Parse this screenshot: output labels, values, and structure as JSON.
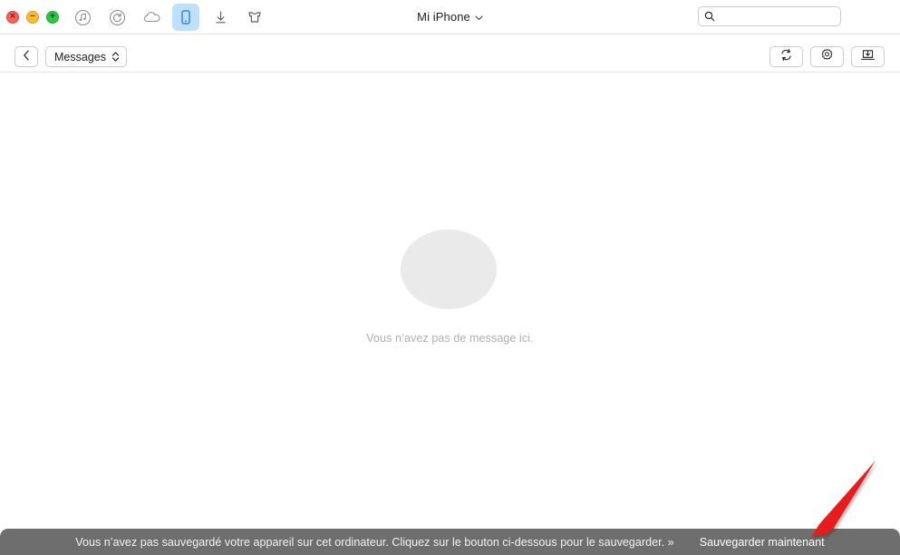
{
  "window": {
    "title": "Mi iPhone",
    "title_chevron": "chevron-down",
    "traffic_lights": {
      "close_glyph": "×",
      "minimize_glyph": "−",
      "maximize_glyph": "+",
      "close_color": "#ff5f57",
      "minimize_color": "#febc2e",
      "maximize_color": "#28c840"
    },
    "nav_icons": [
      {
        "name": "music-icon",
        "label": "Musique",
        "active": false
      },
      {
        "name": "podcast-icon",
        "label": "Podcasts",
        "active": false
      },
      {
        "name": "cloud-icon",
        "label": "iCloud",
        "active": false
      },
      {
        "name": "iphone-device-icon",
        "label": "Appareil",
        "active": true
      },
      {
        "name": "download-icon",
        "label": "Téléchargements",
        "active": false
      },
      {
        "name": "shirt-icon",
        "label": "Boutique",
        "active": false
      }
    ],
    "active_icon_bg": "#bfe0fb",
    "active_icon_color": "#1274d8"
  },
  "search": {
    "value": "",
    "placeholder": "",
    "icon": "search-icon"
  },
  "toolbar": {
    "back_button": {
      "icon": "chevron-left-icon",
      "label": ""
    },
    "category_popup": {
      "label": "Messages",
      "icon": "chevron-up-down-icon"
    },
    "right_buttons": [
      {
        "name": "sync-button",
        "icon": "sync-icon"
      },
      {
        "name": "settings-button",
        "icon": "gear-icon"
      },
      {
        "name": "import-to-computer-button",
        "icon": "import-laptop-icon"
      }
    ]
  },
  "main": {
    "empty_state": {
      "icon": "speech-bubble-icon",
      "message": "Vous n’avez pas de message ici.",
      "bubble_color": "#eaeaea",
      "text_color": "#b0b0b0"
    }
  },
  "banner": {
    "message": "Vous n’avez pas sauvegardé votre appareil sur cet ordinateur. Cliquez sur le bouton ci-dessous pour le sauvegarder. »",
    "action_label": "Sauvegarder maintenant",
    "background_color": "#6e6e6e",
    "text_color": "#f2f2f2"
  },
  "annotation": {
    "arrow": {
      "name": "red-arrow-annotation",
      "color": "#e81b1b",
      "points_to": "Sauvegarder maintenant"
    }
  }
}
